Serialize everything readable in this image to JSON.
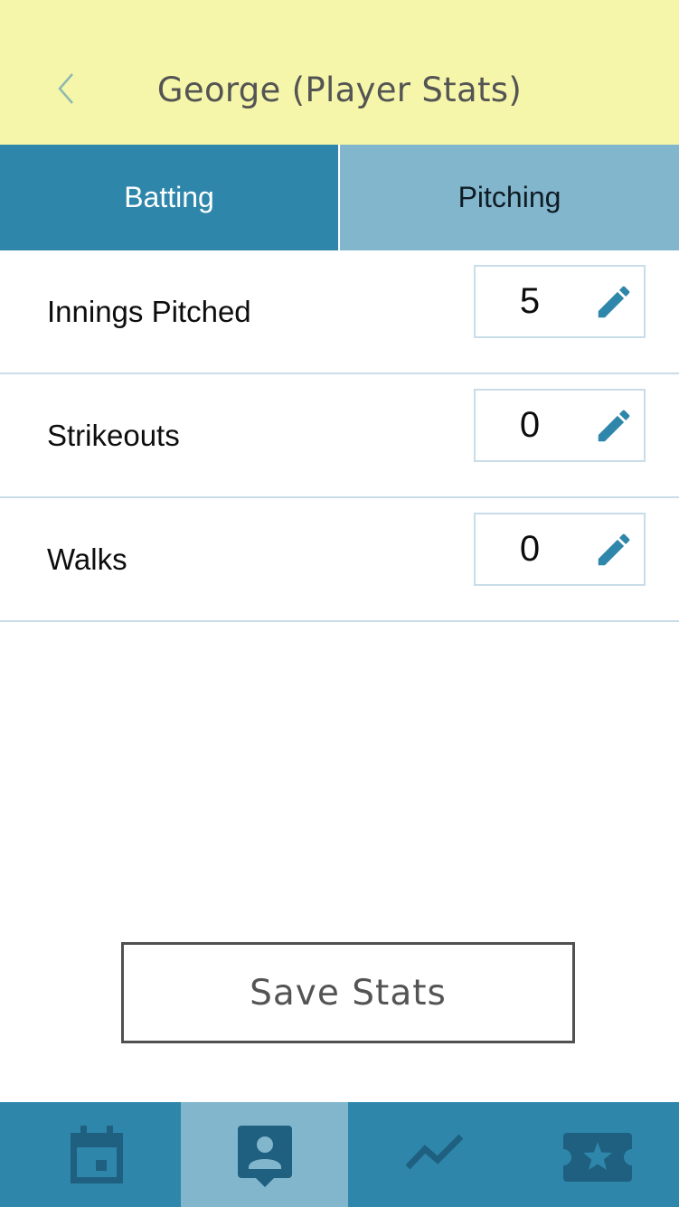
{
  "header": {
    "title": "George (Player Stats)",
    "back_icon": "chevron-left-icon",
    "background_color": "#f5f6a9"
  },
  "tabs": [
    {
      "label": "Batting",
      "selected": false
    },
    {
      "label": "Pitching",
      "selected": true
    }
  ],
  "stats": [
    {
      "label": "Innings Pitched",
      "value": "5",
      "icon": "pencil-icon"
    },
    {
      "label": "Strikeouts",
      "value": "0",
      "icon": "pencil-icon"
    },
    {
      "label": "Walks",
      "value": "0",
      "icon": "pencil-icon"
    }
  ],
  "save_button": {
    "label": "Save Stats"
  },
  "bottom_nav": {
    "items": [
      {
        "icon": "calendar-icon",
        "selected": false
      },
      {
        "icon": "player-profile-icon",
        "selected": true
      },
      {
        "icon": "trend-line-icon",
        "selected": false
      },
      {
        "icon": "ticket-star-icon",
        "selected": false
      }
    ]
  },
  "colors": {
    "accent": "#2f86ab",
    "accent_light": "#82b6cd",
    "icon_dark": "#1f5f7f",
    "divider": "#c9dde8"
  }
}
